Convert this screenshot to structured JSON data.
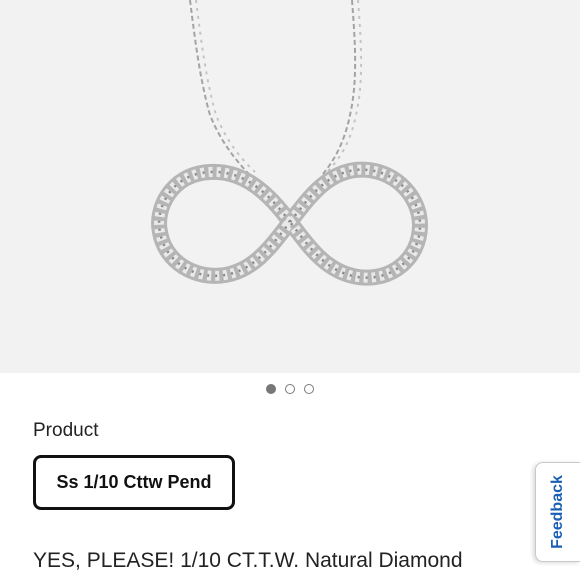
{
  "gallery": {
    "image_alt": "infinity-pendant-necklace-image",
    "slide_count": 3,
    "active_slide": 1
  },
  "product": {
    "option_label": "Product",
    "selected_option": "Ss 1/10 Cttw Pend",
    "title": "YES, PLEASE! 1/10 CT.T.W. Natural Diamond"
  },
  "feedback": {
    "label": "Feedback"
  },
  "colors": {
    "hero_background": "#f2f2f2",
    "feedback_text": "#1a5fb4",
    "chip_border": "#111111",
    "dot_active": "#777777"
  }
}
